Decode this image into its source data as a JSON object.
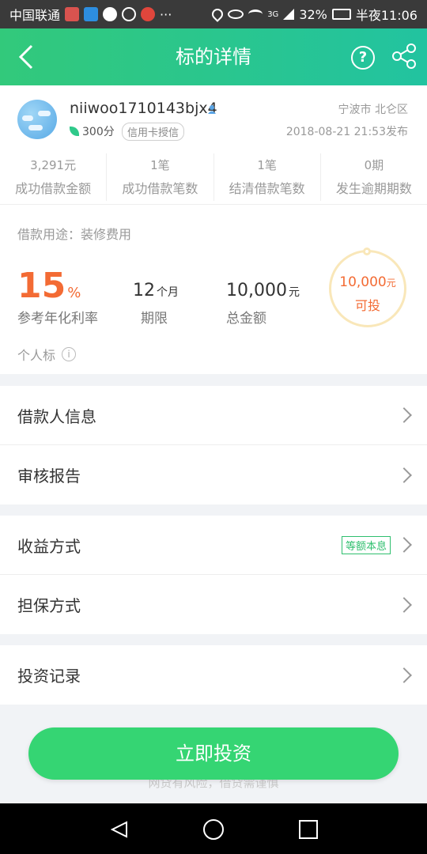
{
  "statusbar": {
    "carrier": "中国联通",
    "more": "···",
    "network": "3G",
    "battery": "32%",
    "time": "半夜11:06"
  },
  "header": {
    "title": "标的详情",
    "back_icon": "chevron-left-icon",
    "help_icon": "question-icon",
    "help_label": "?",
    "share_icon": "share-icon"
  },
  "borrower": {
    "username": "niiwoo1710143bjx4",
    "score": "300分",
    "credit_tag": "信用卡授信",
    "location": "宁波市 北仑区",
    "published": "2018-08-21 21:53发布"
  },
  "stats": [
    {
      "value": "3,291元",
      "label": "成功借款金额"
    },
    {
      "value": "1笔",
      "label": "成功借款笔数"
    },
    {
      "value": "1笔",
      "label": "结清借款笔数"
    },
    {
      "value": "0期",
      "label": "发生逾期期数"
    }
  ],
  "loan": {
    "purpose": "借款用途：装修费用",
    "rate_value": "15",
    "rate_unit": "%",
    "rate_label": "参考年化利率",
    "term_value": "12",
    "term_unit": "个月",
    "term_label": "期限",
    "amount_value": "10,000",
    "amount_unit": "元",
    "amount_label": "总金额",
    "available_value": "10,000",
    "available_unit": "元",
    "available_status": "可投",
    "personal_label": "个人标",
    "info_icon": "info-icon",
    "info_glyph": "i"
  },
  "sections": {
    "s1": [
      {
        "label": "借款人信息"
      },
      {
        "label": "审核报告"
      }
    ],
    "s2": [
      {
        "label": "收益方式",
        "tag": "等额本息"
      },
      {
        "label": "担保方式"
      }
    ],
    "s3": [
      {
        "label": "投资记录"
      }
    ]
  },
  "footer": {
    "risk_text": "网贷有风险，借贷需谨慎",
    "invest_button": "立即投资"
  },
  "colors": {
    "brand_green": "#35d573",
    "accent_orange": "#f36b34"
  }
}
